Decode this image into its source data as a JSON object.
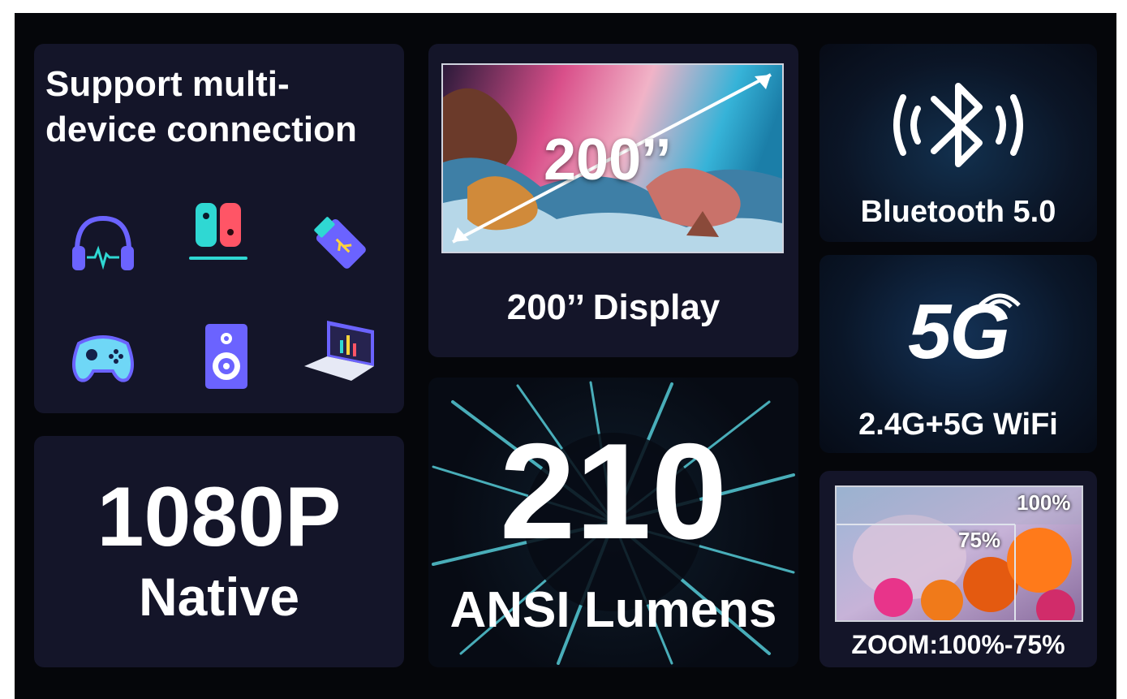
{
  "multi_device": {
    "title": "Support multi-device connection",
    "devices": [
      "headphones-icon",
      "game-console-icon",
      "usb-stick-icon",
      "gamepad-icon",
      "speaker-icon",
      "laptop-icon"
    ]
  },
  "native": {
    "resolution": "1080P",
    "label": "Native"
  },
  "display": {
    "overlay_text": "200’’",
    "caption": "200’’ Display"
  },
  "brightness": {
    "value": "210",
    "unit": "ANSI Lumens"
  },
  "bluetooth": {
    "caption": "Bluetooth 5.0"
  },
  "wifi": {
    "logo_text": "5G",
    "caption": "2.4G+5G WiFi"
  },
  "zoom": {
    "label_outer": "100%",
    "label_inner": "75%",
    "caption": "ZOOM:100%-75%"
  },
  "colors": {
    "background": "#05060a",
    "card": "#141529",
    "accent_blue": "#6b63ff",
    "accent_cyan": "#2fd8d3"
  }
}
